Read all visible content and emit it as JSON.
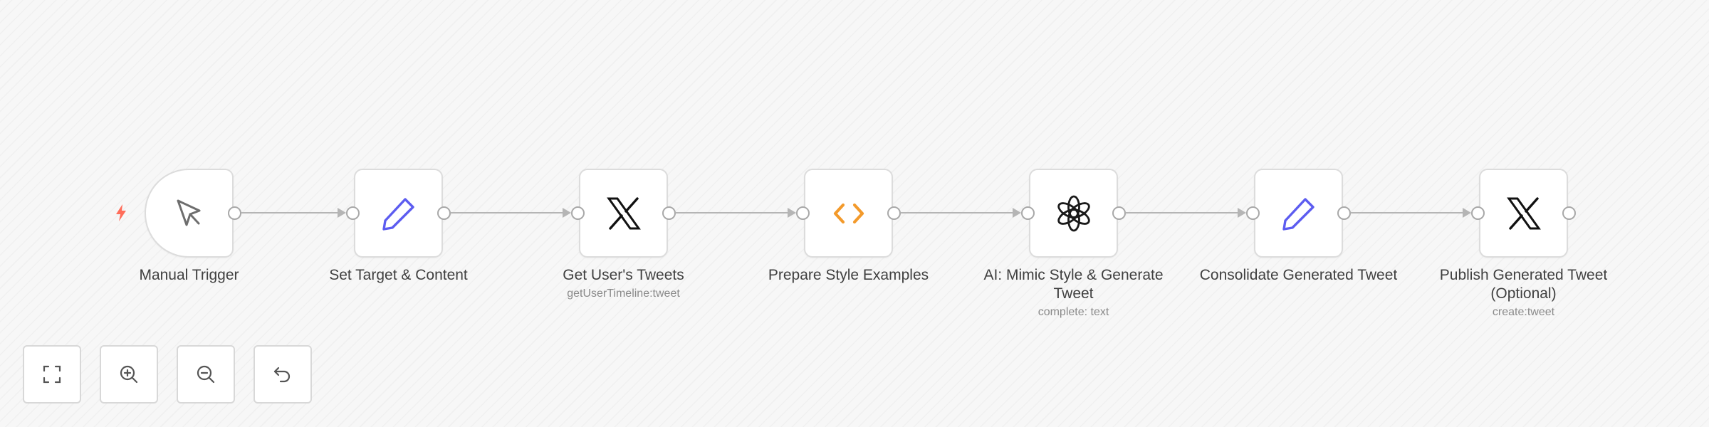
{
  "workflow": {
    "nodes": [
      {
        "id": "manual-trigger",
        "label": "Manual Trigger",
        "sublabel": "",
        "icon": "cursor-pointer-icon",
        "type": "trigger"
      },
      {
        "id": "set-target",
        "label": "Set Target & Content",
        "sublabel": "",
        "icon": "pencil-icon",
        "type": "set"
      },
      {
        "id": "get-tweets",
        "label": "Get User's Tweets",
        "sublabel": "getUserTimeline:tweet",
        "icon": "x-logo-icon",
        "type": "x"
      },
      {
        "id": "prepare-style",
        "label": "Prepare Style Examples",
        "sublabel": "",
        "icon": "code-brackets-icon",
        "type": "code"
      },
      {
        "id": "ai-mimic",
        "label": "AI: Mimic Style & Generate Tweet",
        "sublabel": "complete: text",
        "icon": "openai-logo-icon",
        "type": "openai"
      },
      {
        "id": "consolidate",
        "label": "Consolidate Generated Tweet",
        "sublabel": "",
        "icon": "pencil-icon",
        "type": "set"
      },
      {
        "id": "publish",
        "label": "Publish Generated Tweet (Optional)",
        "sublabel": "create:tweet",
        "icon": "x-logo-icon",
        "type": "x"
      }
    ],
    "trigger_badge_icon": "lightning-bolt-icon"
  },
  "controls": [
    {
      "id": "fit-view",
      "icon": "fit-view-icon"
    },
    {
      "id": "zoom-in",
      "icon": "zoom-in-icon"
    },
    {
      "id": "zoom-out",
      "icon": "zoom-out-icon"
    },
    {
      "id": "reset",
      "icon": "undo-icon"
    }
  ],
  "colors": {
    "accent_pencil": "#5c5cf0",
    "accent_code": "#f39a2b",
    "trigger_bolt": "#ff6d5a",
    "edge": "#b5b5b5",
    "node_border": "#dcdcdc",
    "label_text": "#404040",
    "sublabel_text": "#8a8a8a"
  }
}
